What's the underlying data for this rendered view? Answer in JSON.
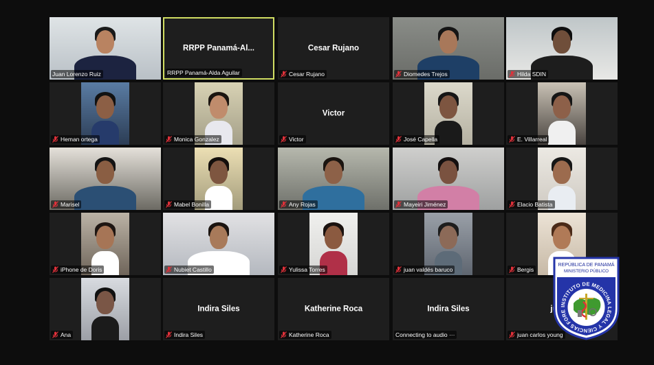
{
  "colors": {
    "muted_mic": "#e0313a",
    "active_border": "#d2df63",
    "tile_bg": "#1e1e1e"
  },
  "participants": [
    {
      "name": "Juan Lorenzo Ruiz",
      "center": "",
      "muted": false,
      "video": true
    },
    {
      "name": "RRPP Panamá-Alda Aguilar",
      "center": "RRPP  Panamá-Al...",
      "muted": false,
      "video": false,
      "active": true
    },
    {
      "name": "Cesar Rujano",
      "center": "Cesar Rujano",
      "muted": true,
      "video": false
    },
    {
      "name": "Diomedes Trejos",
      "center": "",
      "muted": true,
      "video": true
    },
    {
      "name": "Hilda SDIN",
      "center": "",
      "muted": true,
      "video": true
    },
    {
      "name": "Heman ortega",
      "center": "",
      "muted": true,
      "video": true
    },
    {
      "name": "Monica Gonzalez",
      "center": "",
      "muted": true,
      "video": true
    },
    {
      "name": "Victor",
      "center": "Victor",
      "muted": true,
      "video": false
    },
    {
      "name": "José Capella",
      "center": "",
      "muted": true,
      "video": true
    },
    {
      "name": "E. Villarreal",
      "center": "",
      "muted": true,
      "video": true
    },
    {
      "name": "Marisel",
      "center": "",
      "muted": true,
      "video": true
    },
    {
      "name": "Mabel Bonilla",
      "center": "",
      "muted": true,
      "video": true
    },
    {
      "name": "Any Rojas",
      "center": "",
      "muted": true,
      "video": true
    },
    {
      "name": "Mayeiri Jiménez",
      "center": "",
      "muted": true,
      "video": true
    },
    {
      "name": "Elacio Batista",
      "center": "",
      "muted": true,
      "video": true
    },
    {
      "name": "iPhone de Doris",
      "center": "",
      "muted": true,
      "video": true
    },
    {
      "name": "Nubiet Castillo",
      "center": "",
      "muted": true,
      "video": true
    },
    {
      "name": "Yulissa Torres",
      "center": "",
      "muted": true,
      "video": true
    },
    {
      "name": "juan valdés baruco",
      "center": "",
      "muted": true,
      "video": true
    },
    {
      "name": "Bergis",
      "center": "",
      "muted": true,
      "video": true
    },
    {
      "name": "Ana",
      "center": "",
      "muted": true,
      "video": true
    },
    {
      "name": "Indira Siles",
      "center": "Indira Siles",
      "muted": true,
      "video": false
    },
    {
      "name": "Katherine Roca",
      "center": "Katherine Roca",
      "muted": true,
      "video": false
    },
    {
      "name": "Connecting to audio ···",
      "center": "Indira Siles",
      "muted": false,
      "video": false
    },
    {
      "name": "juan carlos young",
      "center": "juan c",
      "muted": true,
      "video": false
    }
  ],
  "logo": {
    "line1": "REPÚBLICA DE PANAMÁ",
    "line2": "MINISTERIO PÚBLICO",
    "arc_text": "INSTITUTO DE MEDICINA LEGAL Y CIENCIAS FORENSES"
  }
}
